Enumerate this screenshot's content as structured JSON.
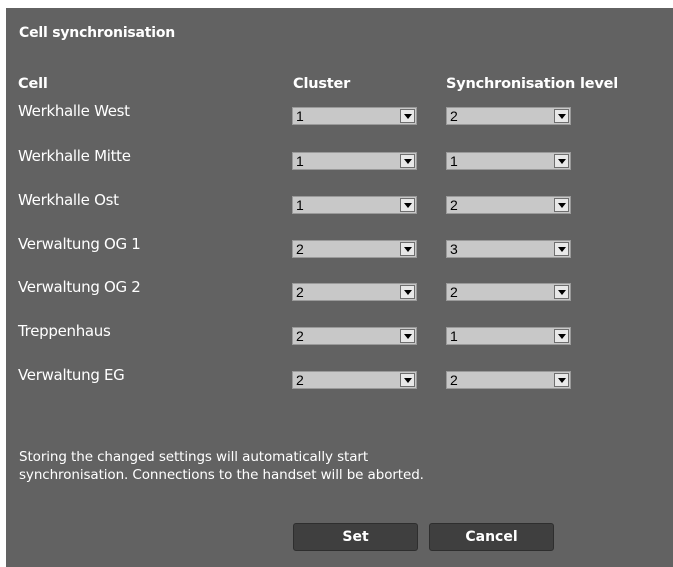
{
  "panel": {
    "title": "Cell synchronisation"
  },
  "table": {
    "headers": {
      "cell": "Cell",
      "cluster": "Cluster",
      "sync_level": "Synchronisation level"
    },
    "rows": [
      {
        "cell": "Werkhalle West",
        "cluster": "1",
        "sync_level": "2"
      },
      {
        "cell": "Werkhalle Mitte",
        "cluster": "1",
        "sync_level": "1"
      },
      {
        "cell": "Werkhalle Ost",
        "cluster": "1",
        "sync_level": "2"
      },
      {
        "cell": "Verwaltung OG 1",
        "cluster": "2",
        "sync_level": "3"
      },
      {
        "cell": "Verwaltung OG 2",
        "cluster": "2",
        "sync_level": "2"
      },
      {
        "cell": "Treppenhaus",
        "cluster": "2",
        "sync_level": "1"
      },
      {
        "cell": "Verwaltung EG",
        "cluster": "2",
        "sync_level": "2"
      }
    ]
  },
  "info": {
    "line1": "Storing the changed settings will automatically start",
    "line2": "synchronisation. Connections to the handset will be aborted."
  },
  "buttons": {
    "set_label": "Set",
    "cancel_label": "Cancel"
  },
  "colors": {
    "panel_background": "#626262",
    "select_background": "#c8c8c8",
    "button_background": "#3f3f3f",
    "text": "#ffffff"
  },
  "icons": {
    "dropdown": "chevron-down-icon"
  }
}
